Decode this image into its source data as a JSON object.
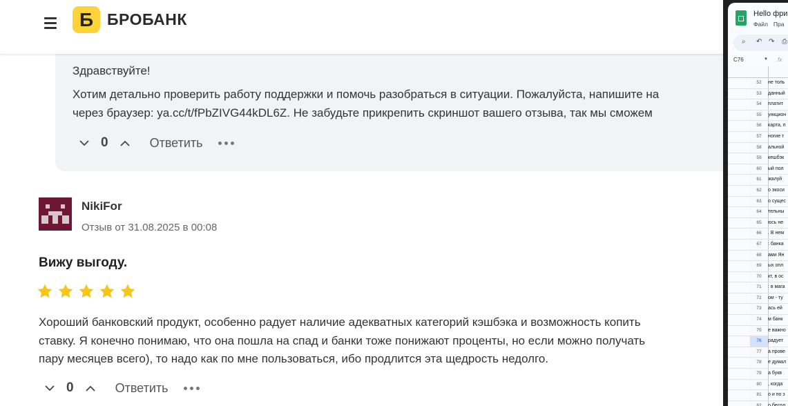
{
  "header": {
    "logo_letter": "Б",
    "logo_text": "БРОБАНК"
  },
  "reply": {
    "greeting": "Здравствуйте!",
    "line1": "Хотим детально проверить работу поддержки и помочь разобраться в ситуации. Пожалуйста, напишите на",
    "line2": "через браузер: ya.cc/t/fPbZIVG44kDL6Z. Не забудьте прикрепить скриншот вашего отзыва, так мы сможем",
    "votes": "0",
    "reply_label": "Ответить"
  },
  "review": {
    "author": "NikiFor",
    "date": "Отзыв от 31.08.2025 в 00:08",
    "title": "Вижу выгоду.",
    "rating": 5,
    "star_color": "#f5c518",
    "line1": "Хороший банковский продукт, особенно радует наличие адекватных категорий кэшбэка и возможность копить",
    "line2": "ставку. Я конечно понимаю, что она пошла на спад и банки тоже понижают проценты, но если можно получать",
    "line3": "пару месяцев всего), то надо как по мне пользоваться, ибо продлится эта щедрость недолго.",
    "votes": "0",
    "reply_label": "Ответить"
  },
  "sheets": {
    "title": "Hello фри",
    "menu": [
      "Файл",
      "Пра"
    ],
    "name_box": "C76",
    "fx": "fx",
    "rows": [
      {
        "num": "52",
        "text": "не толь"
      },
      {
        "num": "53",
        "text": "данный"
      },
      {
        "num": "54",
        "text": "платит"
      },
      {
        "num": "55",
        "text": "ункцион"
      },
      {
        "num": "56",
        "text": "карта, п"
      },
      {
        "num": "57",
        "text": "ногие т"
      },
      {
        "num": "58",
        "text": "альной"
      },
      {
        "num": "59",
        "text": "кешбэк"
      },
      {
        "num": "60",
        "text": "ый пол"
      },
      {
        "num": "61",
        "text": "жалуй"
      },
      {
        "num": "62",
        "text": "о экоси"
      },
      {
        "num": "63",
        "text": "о сущес"
      },
      {
        "num": "64",
        "text": "тельны"
      },
      {
        "num": "65",
        "text": "юсь не"
      },
      {
        "num": "66",
        "text": ". В нем"
      },
      {
        "num": "67",
        "text": ": банка"
      },
      {
        "num": "68",
        "text": "ами Ян"
      },
      {
        "num": "69",
        "text": "ых опл"
      },
      {
        "num": "70",
        "text": "кт, в ос"
      },
      {
        "num": "71",
        "text": ": в мага"
      },
      {
        "num": "72",
        "text": "ом - ту"
      },
      {
        "num": "73",
        "text": "ась ей"
      },
      {
        "num": "74",
        "text": "м банк"
      },
      {
        "num": "75",
        "text": "е важно"
      },
      {
        "num": "76",
        "text": "радует"
      },
      {
        "num": "77",
        "text": "а прове"
      },
      {
        "num": "78",
        "text": "е думал"
      },
      {
        "num": "79",
        "text": "а букв"
      },
      {
        "num": "80",
        "text": ", когда"
      },
      {
        "num": "81",
        "text": "о и по з"
      },
      {
        "num": "82",
        "text": "о беспл"
      },
      {
        "num": "83",
        "text": ""
      }
    ],
    "selected_row": "76"
  }
}
